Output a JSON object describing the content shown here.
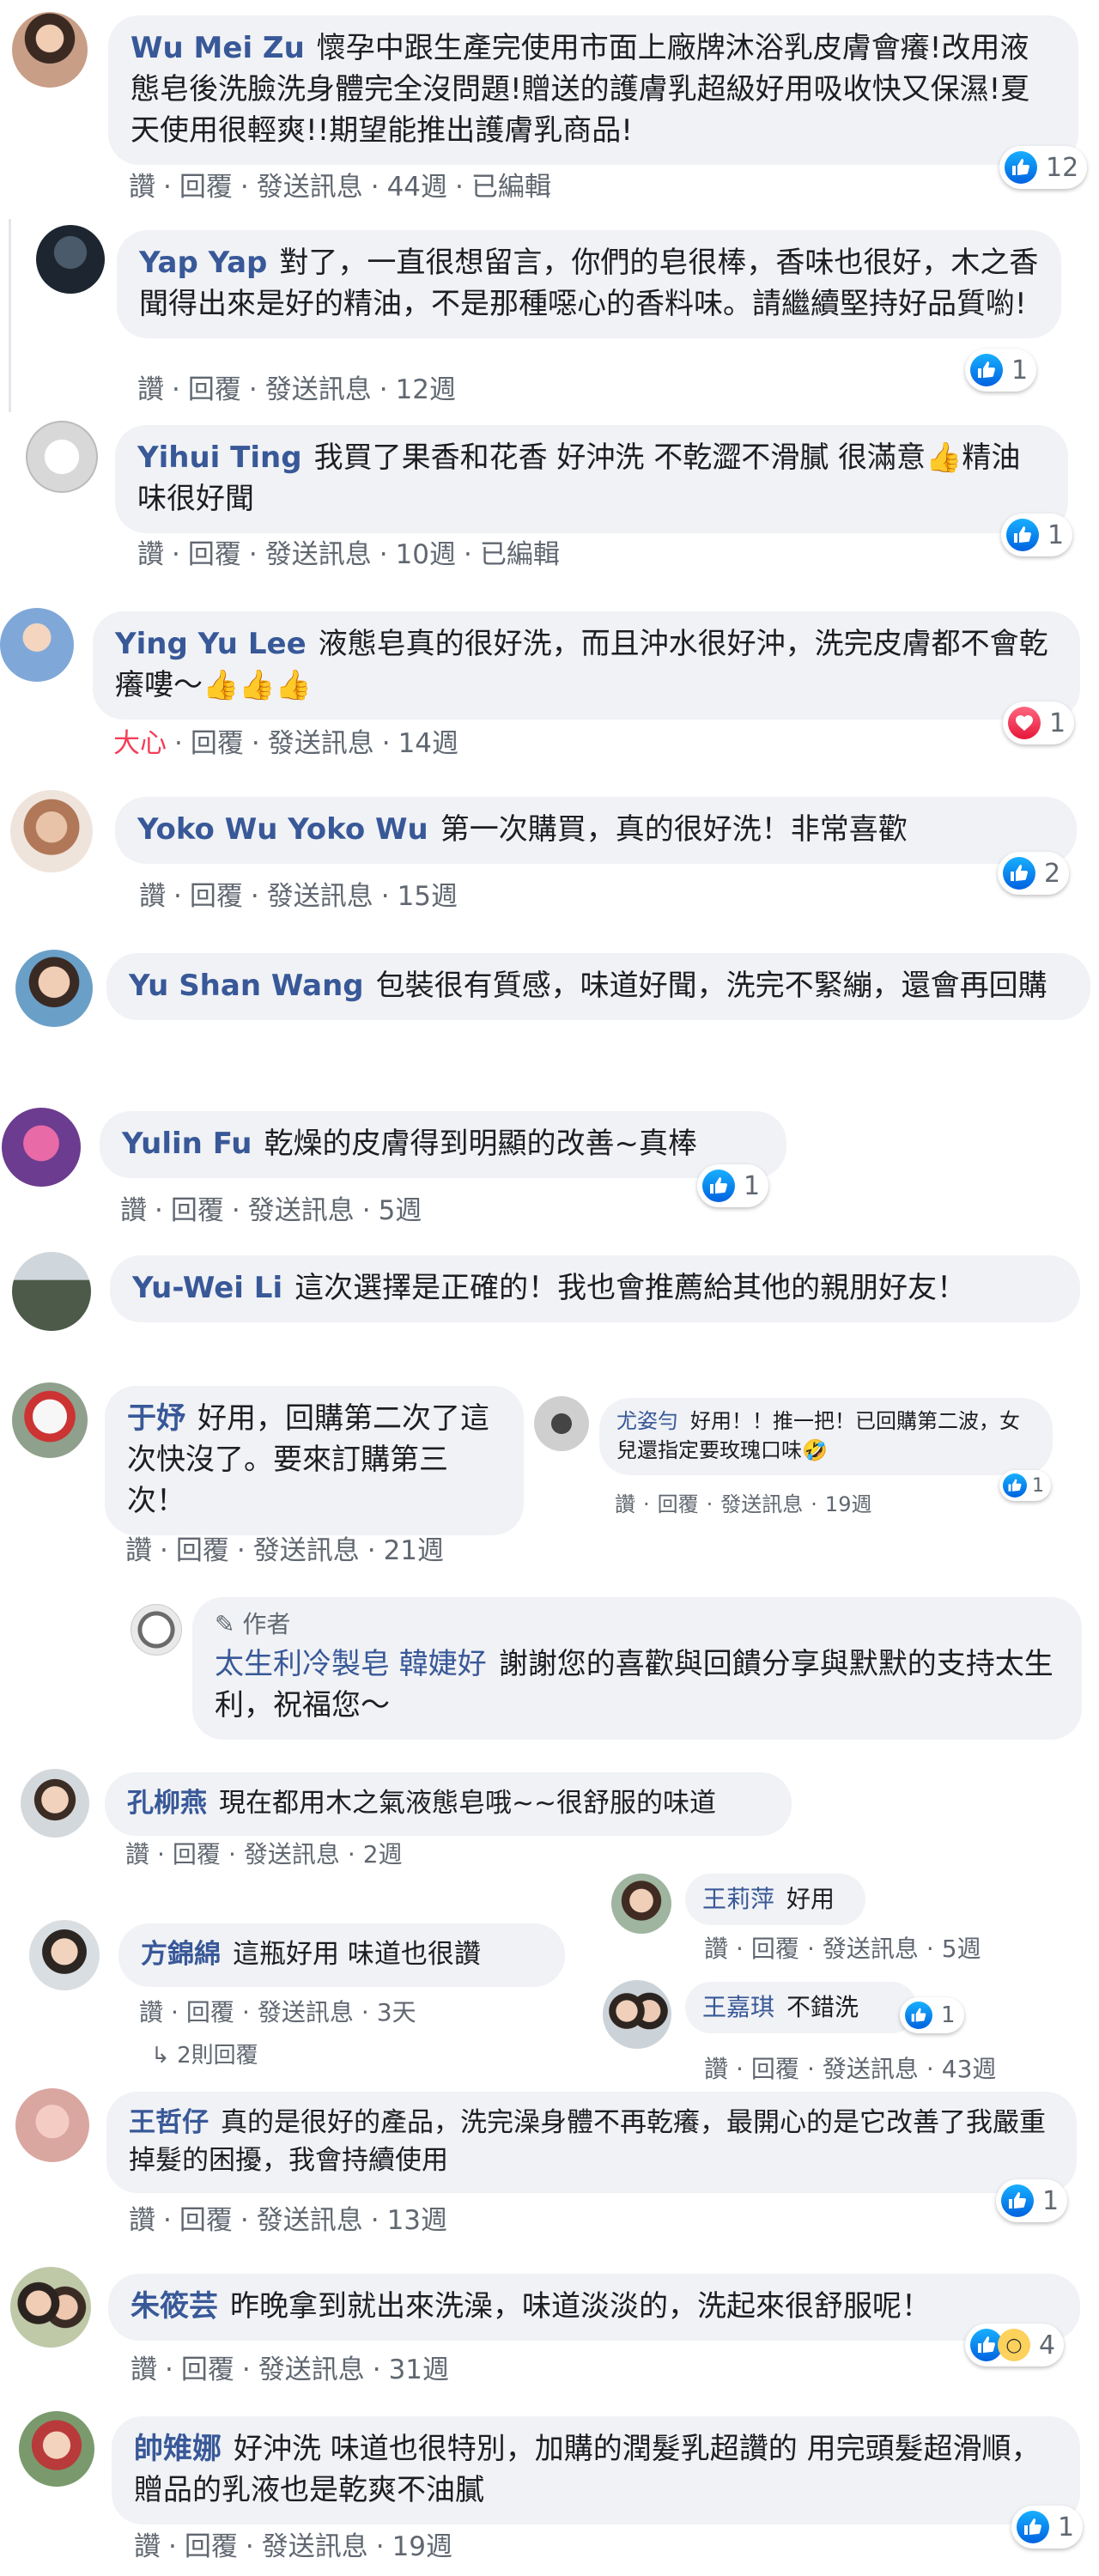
{
  "actions": {
    "like": "讚",
    "reply": "回覆",
    "message": "發送訊息",
    "edited": "已編輯",
    "love": "大心",
    "sep": "·"
  },
  "comments": [
    {
      "name": "Wu Mei Zu",
      "text": "懷孕中跟生產完使用市面上廠牌沐浴乳皮膚會癢!改用液態皂後洗臉洗身體完全沒問題!贈送的護膚乳超級好用吸收快又保濕!夏天使用很輕爽!!期望能推出護膚乳商品!",
      "time": "44週",
      "edited": "已編輯",
      "reactions": "12"
    },
    {
      "name": "Yap Yap",
      "text": "對了，一直很想留言，你們的皂很棒，香味也很好，木之香聞得出來是好的精油，不是那種噁心的香料味。請繼續堅持好品質喲!",
      "time": "12週",
      "reactions": "1"
    },
    {
      "name": "Yihui Ting",
      "text": "我買了果香和花香 好沖洗 不乾澀不滑膩 很滿意👍精油味很好聞",
      "time": "10週",
      "edited": "已編輯",
      "reactions": "1"
    },
    {
      "name": "Ying Yu Lee",
      "text": "液態皂真的很好洗，而且沖水很好沖，洗完皮膚都不會乾癢嘍～👍👍👍",
      "time": "14週",
      "reactions": "1"
    },
    {
      "name": "Yoko Wu Yoko Wu",
      "text": "第一次購買，真的很好洗！非常喜歡",
      "time": "15週",
      "reactions": "2"
    },
    {
      "name": "Yu Shan Wang",
      "text": "包裝很有質感，味道好聞，洗完不緊繃，還會再回購"
    },
    {
      "name": "Yulin Fu",
      "text": "乾燥的皮膚得到明顯的改善~真棒",
      "time": "5週",
      "reactions": "1"
    },
    {
      "name": "Yu-Wei Li",
      "text": "這次選擇是正確的！我也會推薦給其他的親朋好友！"
    },
    {
      "name": "于妤",
      "text": "好用，回購第二次了這次快沒了。要來訂購第三次！",
      "time": "21週"
    },
    {
      "name": "孔柳燕",
      "text": "現在都用木之氣液態皂哦~~很舒服的味道",
      "time": "2週"
    },
    {
      "name": "方錦綿",
      "text": "這瓶好用 味道也很讚",
      "time": "3天"
    },
    {
      "name": "王哲仔",
      "text": "真的是很好的產品，洗完澡身體不再乾癢，最開心的是它改善了我嚴重掉髮的困擾，我會持續使用",
      "time": "13週",
      "reactions": "1"
    },
    {
      "name": "朱筱芸",
      "text": "昨晚拿到就出來洗澡，味道淡淡的，洗起來很舒服呢！",
      "time": "31週",
      "reactions": "4"
    },
    {
      "name": "帥雉娜",
      "text": "好沖洗 味道也很特別，加購的潤髮乳超讚的 用完頭髮超滑順，贈品的乳液也是乾爽不油膩",
      "time": "19週",
      "reactions": "1"
    }
  ],
  "replies": [
    {
      "name": "尤姿勻",
      "text": "好用！！推一把！已回購第二波，女兒還指定要玫瑰口味🤣",
      "time": "19週",
      "reactions": "1"
    },
    {
      "author_tag": "作者",
      "name": "太生利冷製皂 韓婕好",
      "text": "謝謝您的喜歡與回饋分享與默默的支持太生利，祝福您～"
    },
    {
      "name": "王莉萍",
      "text": "好用",
      "time": "5週"
    },
    {
      "name": "王嘉琪",
      "text": "不錯洗",
      "time": "43週",
      "reactions": "1"
    }
  ],
  "more_replies": "2則回覆",
  "colors": {
    "name": "#385898",
    "bubble": "#f0f2f5",
    "meta": "#606770",
    "like_blue": "#0062df",
    "love_red": "#f33e58"
  }
}
